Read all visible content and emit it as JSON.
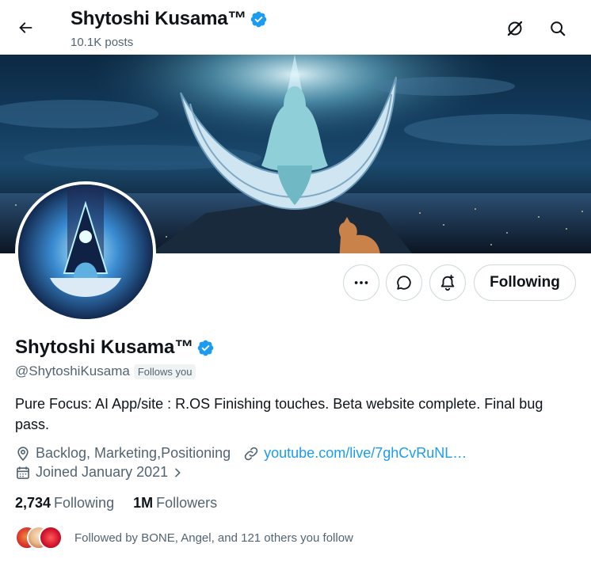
{
  "header": {
    "title": "Shytoshi Kusama™",
    "subtitle": "10.1K posts"
  },
  "profile": {
    "name": "Shytoshi Kusama™",
    "handle": "@ShytoshiKusama",
    "follows_you_badge": "Follows you",
    "bio": "Pure Focus: AI App/site : R.OS Finishing touches. Beta website complete. Final bug pass.",
    "location": "Backlog, Marketing,Positioning",
    "link": "youtube.com/live/7ghCvRuNL…",
    "joined": "Joined January 2021",
    "following_count": "2,734",
    "following_label": "Following",
    "followers_count": "1M",
    "followers_label": "Followers",
    "followed_by": "Followed by BONE, Angel, and 121 others you follow"
  },
  "actions": {
    "following_button": "Following"
  },
  "icons": {
    "back": "arrow-left-icon",
    "grok": "grok-icon",
    "search": "search-icon",
    "verified": "verified-badge-icon",
    "more": "more-icon",
    "message": "message-icon",
    "notify": "notification-bell-icon",
    "location": "location-pin-icon",
    "link": "link-icon",
    "calendar": "calendar-icon",
    "chevron": "chevron-right-icon"
  },
  "colors": {
    "verified_blue": "#1d9bf0",
    "link_blue": "#1d9bf0",
    "text_primary": "#0f1419",
    "text_secondary": "#536471",
    "border": "#cfd9de"
  }
}
